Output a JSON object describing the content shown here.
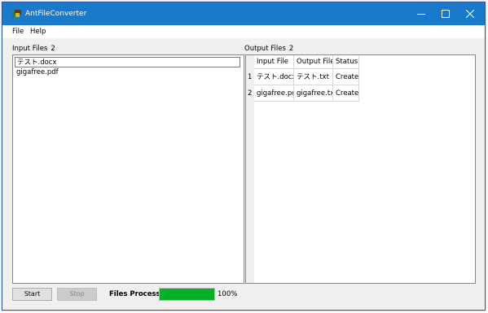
{
  "window": {
    "title": "AntFileConverter"
  },
  "menu": {
    "file": "File",
    "help": "Help"
  },
  "input": {
    "label": "Input Files",
    "count": "2",
    "files": [
      "テスト.docx",
      "gigafree.pdf"
    ]
  },
  "output": {
    "label": "Output Files",
    "count": "2",
    "columns": [
      "Input File",
      "Output File",
      "Status"
    ],
    "rows": [
      {
        "num": "1",
        "input": "テスト.docx",
        "output": "テスト.txt",
        "status": "Created"
      },
      {
        "num": "2",
        "input": "gigafree.pdf",
        "output": "gigafree.txt",
        "status": "Created"
      }
    ]
  },
  "controls": {
    "start": "Start",
    "stop": "Stop"
  },
  "progress": {
    "label": "Files Processed",
    "percent_text": "100%",
    "fraction": 1.0
  },
  "colors": {
    "titlebar": "#1979ca",
    "progress": "#06b025"
  }
}
